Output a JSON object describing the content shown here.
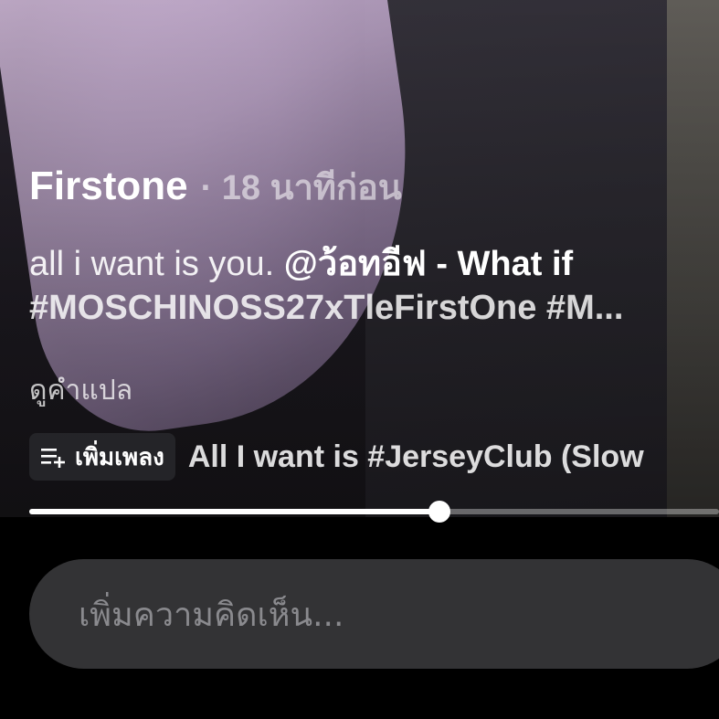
{
  "post": {
    "author": "Firstone",
    "time": "· 18 นาทีก่อน",
    "caption_text": "all i want is you. ",
    "caption_mention": "@ว้อทอีฟ - What if",
    "caption_hashtags": "#MOSCHINOSS27xTleFirstOne #M...",
    "translate_label": "ดูคำแปล"
  },
  "music": {
    "add_song_label": "เพิ่มเพลง",
    "song_title": "All I want is #JerseyClub (Slow"
  },
  "playback": {
    "progress_fraction": 0.595
  },
  "comment": {
    "placeholder": "เพิ่มความคิดเห็น..."
  }
}
